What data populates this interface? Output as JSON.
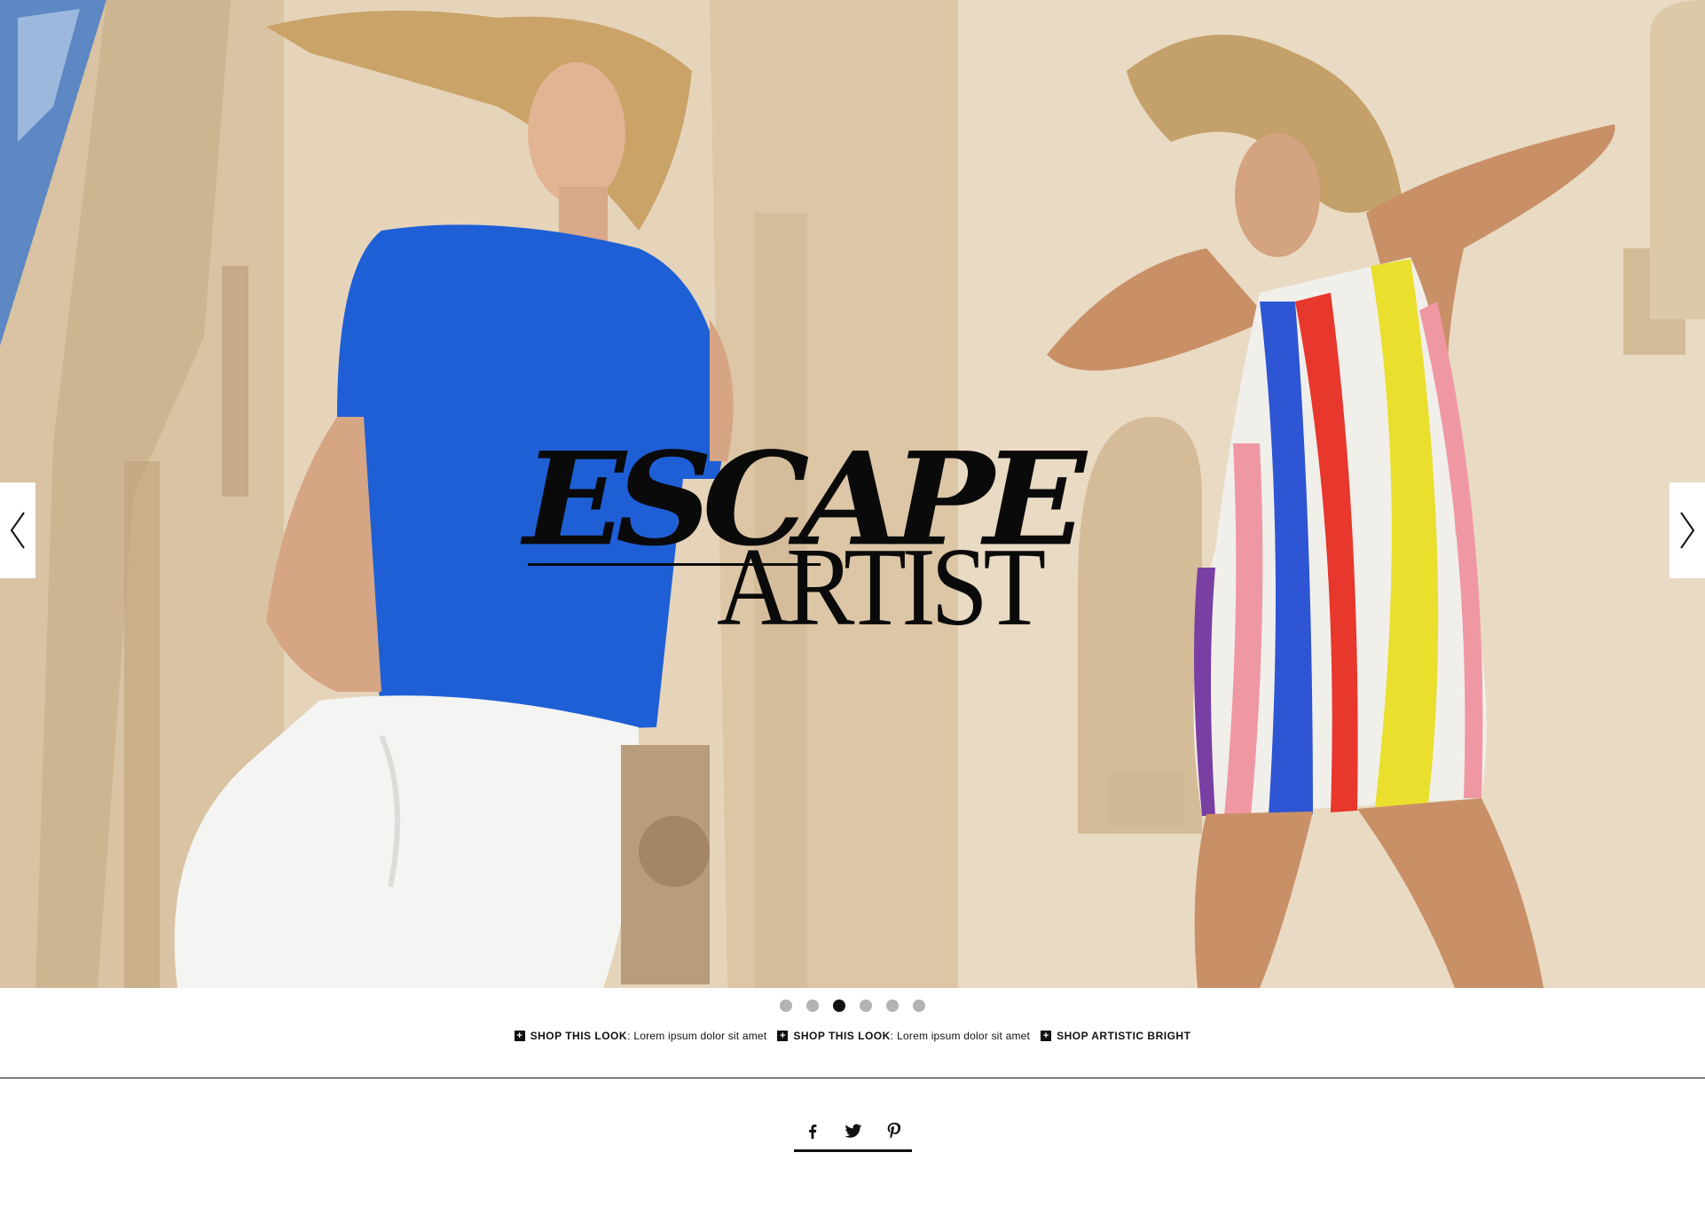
{
  "hero": {
    "headline_line1": "ESCAPE",
    "headline_line2": "ARTIST",
    "prev_icon": "chevron-left-icon",
    "next_icon": "chevron-right-icon"
  },
  "carousel": {
    "slide_count": 6,
    "active_index": 2
  },
  "shop_links": [
    {
      "label": "SHOP THIS LOOK",
      "separator": ":",
      "desc": "Lorem ipsum dolor sit amet",
      "icon": "plus-icon"
    },
    {
      "label": "SHOP THIS LOOK",
      "separator": ":",
      "desc": "Lorem ipsum dolor sit amet",
      "icon": "plus-icon"
    },
    {
      "label": "SHOP ARTISTIC BRIGHT",
      "separator": "",
      "desc": "",
      "icon": "plus-icon"
    }
  ],
  "social": {
    "icons": [
      "facebook-icon",
      "twitter-icon",
      "pinterest-icon"
    ]
  },
  "colors": {
    "accent": "#111111",
    "dot_inactive": "#b3b3b3",
    "background": "#ffffff"
  }
}
